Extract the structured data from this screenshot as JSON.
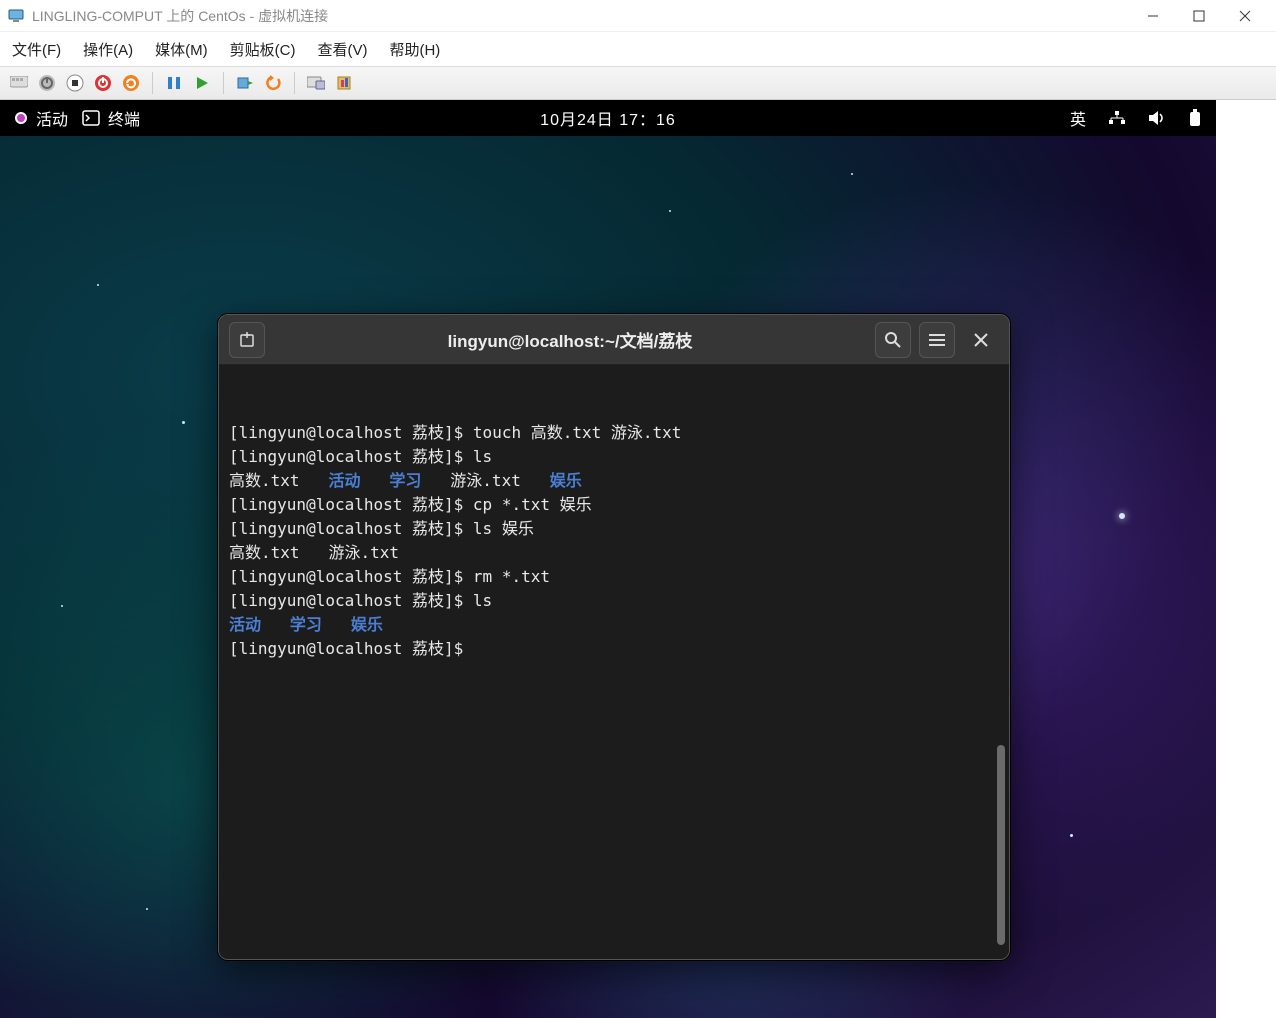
{
  "host_window": {
    "title": "LINGLING-COMPUT 上的 CentOs - 虚拟机连接"
  },
  "menubar": {
    "items": [
      "文件(F)",
      "操作(A)",
      "媒体(M)",
      "剪贴板(C)",
      "查看(V)",
      "帮助(H)"
    ]
  },
  "toolbar_icons": [
    "ctrl-alt-del",
    "power",
    "stop",
    "shutdown",
    "reset",
    "sep",
    "pause",
    "play",
    "sep",
    "checkpoint",
    "revert",
    "sep",
    "enhanced",
    "share"
  ],
  "gnome_topbar": {
    "activities": "活动",
    "app_label": "终端",
    "clock": "10月24日  17：16",
    "input_method": "英"
  },
  "terminal": {
    "title": "lingyun@localhost:~/文档/荔枝",
    "prompt": "[lingyun@localhost 荔枝]$ ",
    "lines": [
      {
        "prompt": "[lingyun@localhost 荔枝]$ ",
        "cmd": "touch 高数.txt 游泳.txt"
      },
      {
        "prompt": "[lingyun@localhost 荔枝]$ ",
        "cmd": "ls"
      },
      {
        "ls": [
          {
            "t": "高数.txt",
            "d": false
          },
          {
            "t": "活动",
            "d": true
          },
          {
            "t": "学习",
            "d": true
          },
          {
            "t": "游泳.txt",
            "d": false
          },
          {
            "t": "娱乐",
            "d": true
          }
        ]
      },
      {
        "prompt": "[lingyun@localhost 荔枝]$ ",
        "cmd": "cp *.txt 娱乐"
      },
      {
        "prompt": "[lingyun@localhost 荔枝]$ ",
        "cmd": "ls 娱乐"
      },
      {
        "ls": [
          {
            "t": "高数.txt",
            "d": false
          },
          {
            "t": "游泳.txt",
            "d": false
          }
        ]
      },
      {
        "prompt": "[lingyun@localhost 荔枝]$ ",
        "cmd": "rm *.txt"
      },
      {
        "prompt": "[lingyun@localhost 荔枝]$ ",
        "cmd": "ls"
      },
      {
        "ls": [
          {
            "t": "活动",
            "d": true
          },
          {
            "t": "学习",
            "d": true
          },
          {
            "t": "娱乐",
            "d": true
          }
        ]
      },
      {
        "prompt": "[lingyun@localhost 荔枝]$ ",
        "cmd": ""
      }
    ]
  }
}
